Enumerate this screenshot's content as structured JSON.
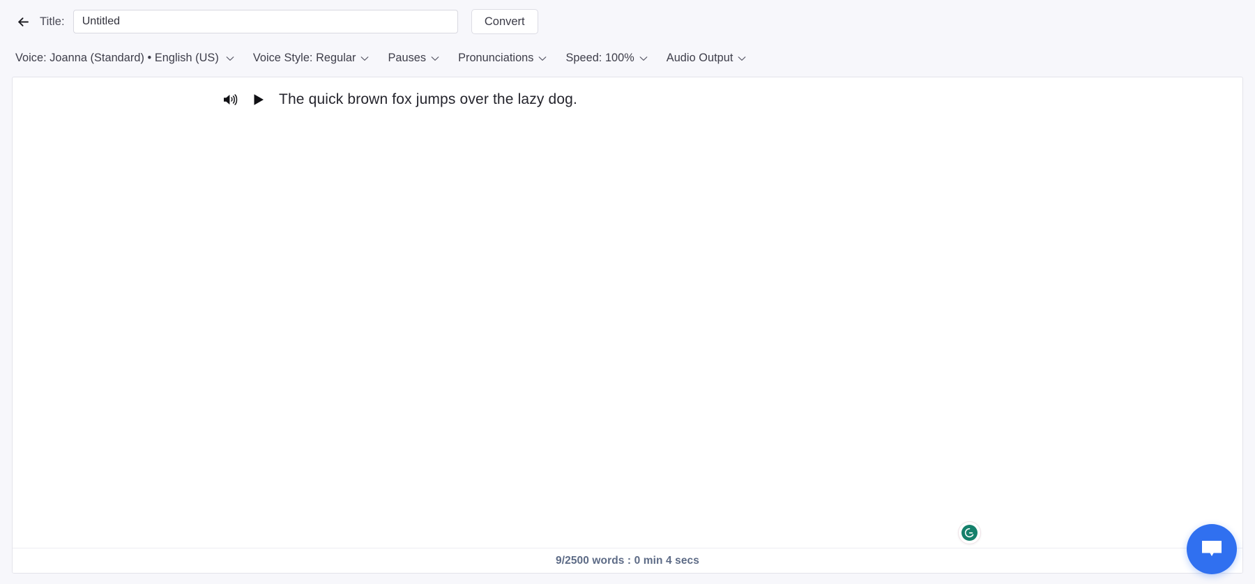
{
  "header": {
    "back_icon": "back-arrow-icon",
    "title_label": "Title:",
    "title_value": "Untitled",
    "title_placeholder": "Untitled",
    "convert_label": "Convert"
  },
  "toolbar": {
    "items": [
      {
        "label": "Voice: Joanna (Standard) • English (US)",
        "caret": "chevron-down-icon",
        "name": "voice"
      },
      {
        "label": "Voice Style: Regular",
        "caret": "chevron-down-icon",
        "name": "voice-style"
      },
      {
        "label": "Pauses",
        "caret": "chevron-down-icon",
        "name": "pauses"
      },
      {
        "label": "Pronunciations",
        "caret": "chevron-down-icon",
        "name": "pronunciations"
      },
      {
        "label": "Speed: 100%",
        "caret": "chevron-down-icon",
        "name": "speed"
      },
      {
        "label": "Audio Output",
        "caret": "chevron-down-icon",
        "name": "audio-output"
      }
    ]
  },
  "editor": {
    "sentences": [
      {
        "speaker_icon": "speaker-volume-icon",
        "play_icon": "play-triangle-icon",
        "text": "The quick brown fox jumps over the lazy dog."
      }
    ],
    "footer": {
      "word_count": "9/2500 words : 0 min 4 secs"
    }
  },
  "widgets": {
    "grammarly": {
      "icon": "grammarly-logo-icon",
      "color": "#15806b"
    },
    "chat": {
      "icon": "chat-bubble-icon",
      "color": "#3070f0"
    }
  },
  "colors": {
    "page_background": "#f7f7fb",
    "panel_background": "#ffffff",
    "panel_border": "#e3e3ea",
    "text_primary": "#25252d",
    "toolbar_text": "#3d3d49",
    "footer_text": "#5d6b86",
    "chat_accent": "#3070f0",
    "grammarly_accent": "#15806b"
  }
}
